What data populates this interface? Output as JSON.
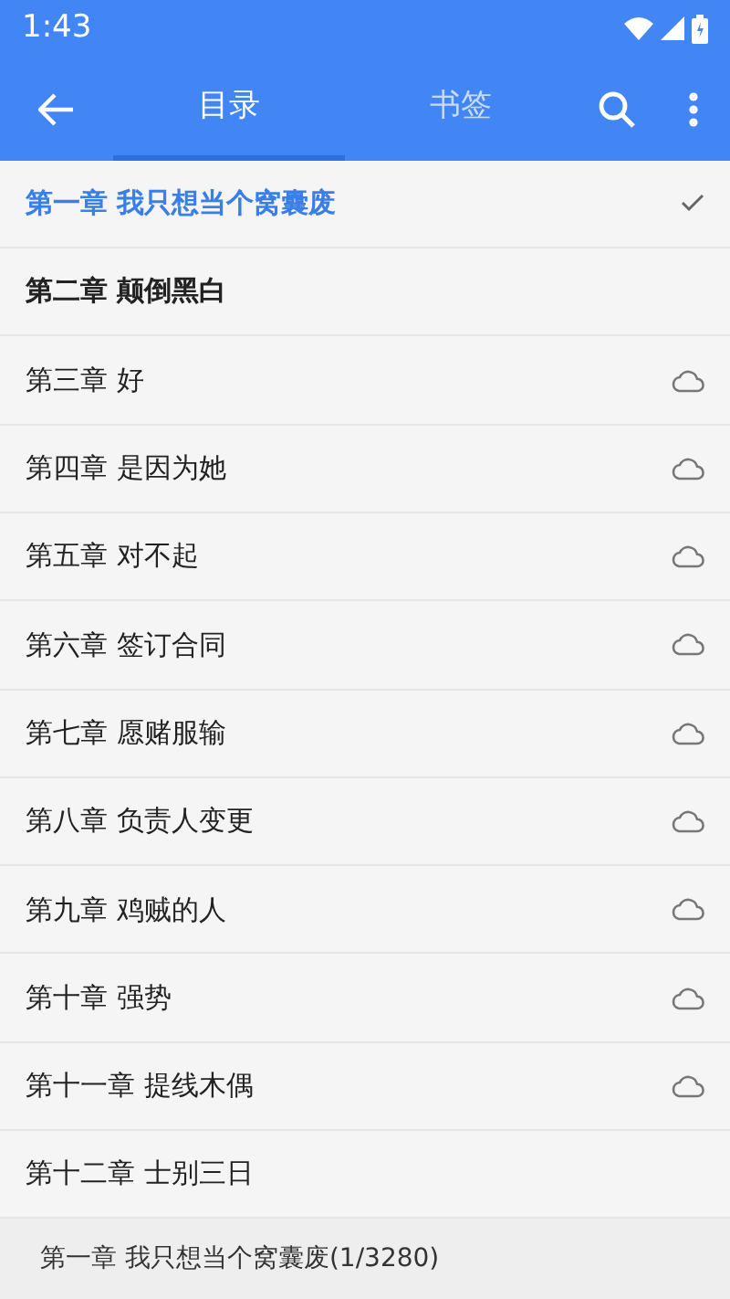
{
  "status_bar": {
    "time": "1:43"
  },
  "tabs": [
    {
      "label": "目录",
      "selected": true
    },
    {
      "label": "书签",
      "selected": false
    }
  ],
  "chapters": [
    {
      "title": "第一章 我只想当个窝囊废",
      "selected": true,
      "bold": true
    },
    {
      "title": "第二章 颠倒黑白",
      "selected": false,
      "bold": true,
      "cloud": false
    },
    {
      "title": "第三章 好",
      "selected": false,
      "bold": false,
      "cloud": true
    },
    {
      "title": "第四章 是因为她",
      "selected": false,
      "bold": false,
      "cloud": true
    },
    {
      "title": "第五章 对不起",
      "selected": false,
      "bold": false,
      "cloud": true
    },
    {
      "title": "第六章 签订合同",
      "selected": false,
      "bold": false,
      "cloud": true
    },
    {
      "title": "第七章 愿赌服输",
      "selected": false,
      "bold": false,
      "cloud": true
    },
    {
      "title": "第八章 负责人变更",
      "selected": false,
      "bold": false,
      "cloud": true
    },
    {
      "title": "第九章 鸡贼的人",
      "selected": false,
      "bold": false,
      "cloud": true
    },
    {
      "title": "第十章 强势",
      "selected": false,
      "bold": false,
      "cloud": true
    },
    {
      "title": "第十一章 提线木偶",
      "selected": false,
      "bold": false,
      "cloud": true
    },
    {
      "title": "第十二章 士别三日",
      "selected": false,
      "bold": false,
      "cloud": false
    }
  ],
  "footer": {
    "current": "第一章 我只想当个窝囊废(1/3280)"
  }
}
